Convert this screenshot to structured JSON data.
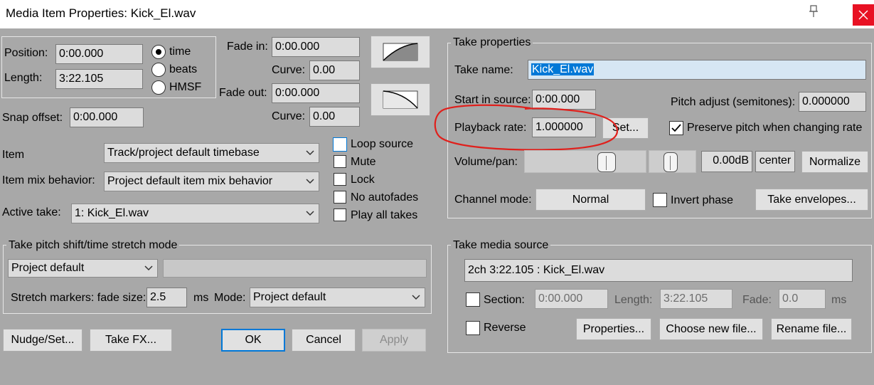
{
  "window": {
    "title": "Media Item Properties:  Kick_El.wav"
  },
  "position": {
    "position_label": "Position:",
    "position_value": "0:00.000",
    "length_label": "Length:",
    "length_value": "3:22.105",
    "snap_label": "Snap offset:",
    "snap_value": "0:00.000",
    "time_units": [
      {
        "label": "time",
        "selected": true
      },
      {
        "label": "beats",
        "selected": false
      },
      {
        "label": "HMSF",
        "selected": false
      }
    ]
  },
  "fades": {
    "fade_in_label": "Fade in:",
    "fade_in_value": "0:00.000",
    "curve_label": "Curve:",
    "fade_in_curve": "0.00",
    "fade_out_label": "Fade out:",
    "fade_out_value": "0:00.000",
    "fade_out_curve": "0.00"
  },
  "item": {
    "timebase_label": "Item",
    "timebase_value": "Track/project default timebase",
    "mix_label": "Item mix behavior:",
    "mix_value": "Project default item mix behavior",
    "active_take_label": "Active take:",
    "active_take_value": "1: Kick_El.wav"
  },
  "flags": [
    {
      "label": "Loop source",
      "checked": false
    },
    {
      "label": "Mute",
      "checked": false
    },
    {
      "label": "Lock",
      "checked": false
    },
    {
      "label": "No autofades",
      "checked": false
    },
    {
      "label": "Play all takes",
      "checked": false
    }
  ],
  "pitch_group": {
    "title": "Take pitch shift/time stretch mode",
    "mode_value": "Project default",
    "stretch_label": "Stretch markers: fade size:",
    "fade_size": "2.5",
    "ms_label": "ms",
    "mode_label": "Mode:",
    "mode2_value": "Project default"
  },
  "bottom_buttons": {
    "nudge": "Nudge/Set...",
    "take_fx": "Take FX...",
    "ok": "OK",
    "cancel": "Cancel",
    "apply": "Apply"
  },
  "take_props": {
    "title": "Take properties",
    "name_label": "Take name:",
    "name_value": "Kick_El.wav",
    "start_label": "Start in source:",
    "start_value": "0:00.000",
    "pitch_label": "Pitch adjust (semitones):",
    "pitch_value": "0.000000",
    "rate_label": "Playback rate:",
    "rate_value": "1.000000",
    "set_button": "Set...",
    "preserve_label": "Preserve pitch when changing rate",
    "preserve_checked": true,
    "volpan_label": "Volume/pan:",
    "volume_db": "0.00dB",
    "pan_value": "center",
    "normalize_button": "Normalize",
    "channel_label": "Channel mode:",
    "channel_value": "Normal",
    "invert_label": "Invert phase",
    "invert_checked": false,
    "envelopes_button": "Take envelopes..."
  },
  "media_source": {
    "title": "Take media source",
    "info": "2ch 3:22.105 : Kick_El.wav",
    "section_label": "Section:",
    "section_value": "0:00.000",
    "length_label": "Length:",
    "length_value": "3:22.105",
    "fade_label": "Fade:",
    "fade_value": "0.0",
    "ms_label": "ms",
    "reverse_label": "Reverse",
    "properties_button": "Properties...",
    "choose_button": "Choose new file...",
    "rename_button": "Rename file..."
  },
  "annotation": {
    "color": "#e0201c"
  }
}
